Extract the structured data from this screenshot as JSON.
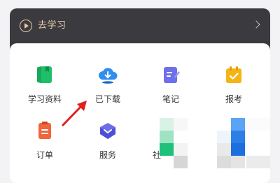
{
  "banner": {
    "label": "去学习"
  },
  "grid": {
    "items": [
      {
        "label": "学习资料",
        "icon": "study-materials-icon"
      },
      {
        "label": "已下载",
        "icon": "download-cloud-icon"
      },
      {
        "label": "笔记",
        "icon": "notes-icon"
      },
      {
        "label": "报考",
        "icon": "exam-registration-icon"
      },
      {
        "label": "订单",
        "icon": "order-icon"
      },
      {
        "label": "服务",
        "icon": "service-icon"
      },
      {
        "label": "社",
        "icon": "community-icon"
      }
    ]
  },
  "colors": {
    "banner_bg": "#3b3b3f",
    "accent_gold": "#ecd0ad",
    "arrow_red": "#e0201b"
  }
}
